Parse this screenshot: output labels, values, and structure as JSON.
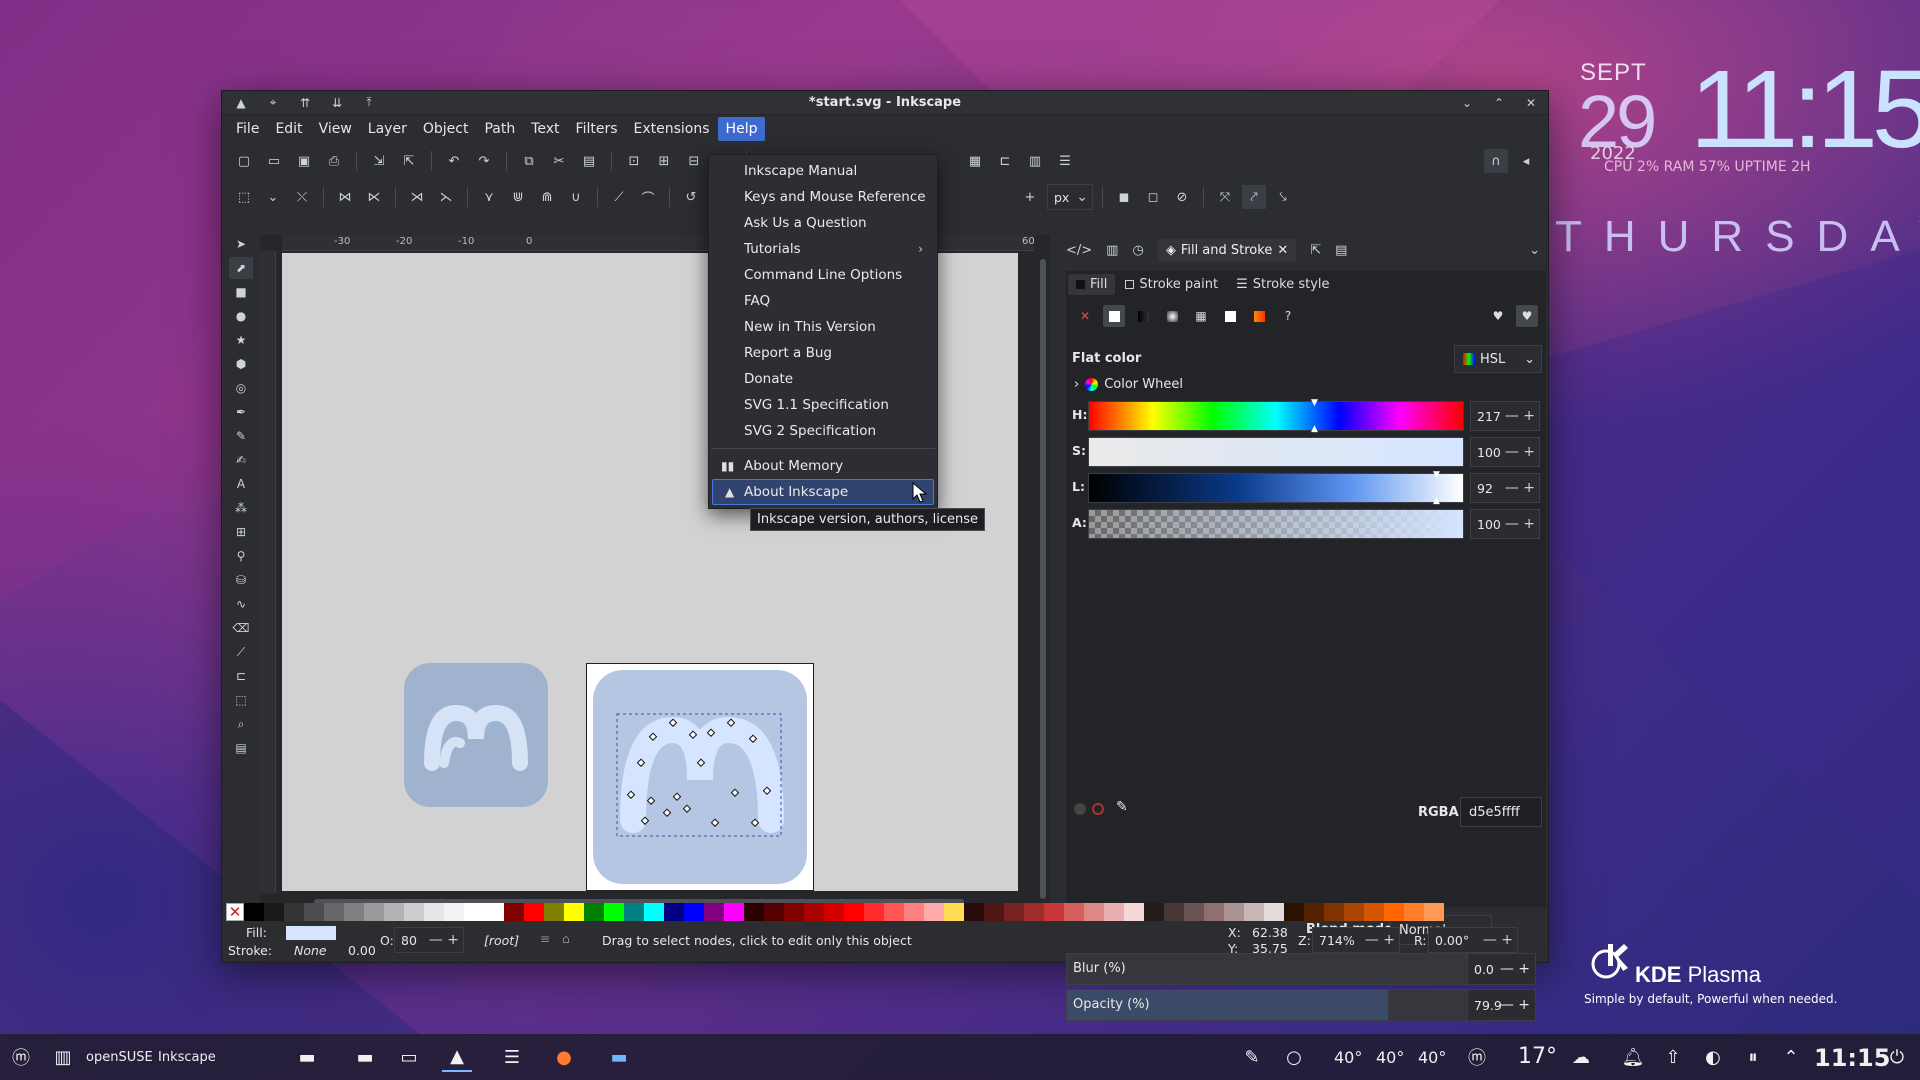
{
  "desktop": {
    "clock": {
      "month": "SEPT",
      "day": "29",
      "time": "11:15",
      "year": "2022",
      "stats": "CPU 2% RAM 57% UPTIME 2H"
    },
    "weekday": "THURSDAY",
    "kde": {
      "name_bold": "KDE",
      "name_rest": " Plasma",
      "tagline": "Simple by default, Powerful when needed."
    }
  },
  "window": {
    "title": "*start.svg - Inkscape",
    "menubar": [
      "File",
      "Edit",
      "View",
      "Layer",
      "Object",
      "Path",
      "Text",
      "Filters",
      "Extensions",
      "Help"
    ],
    "active_menu": "Help",
    "unit": "px",
    "ruler_ticks": [
      "-30",
      "-20",
      "-10",
      "0",
      "60"
    ]
  },
  "help_menu": {
    "items": [
      "Inkscape Manual",
      "Keys and Mouse Reference",
      "Ask Us a Question",
      "Tutorials",
      "Command Line Options",
      "FAQ",
      "New in This Version",
      "Report a Bug",
      "Donate",
      "SVG 1.1 Specification",
      "SVG 2 Specification"
    ],
    "items2": [
      "About Memory",
      "About Inkscape"
    ],
    "tooltip": "Inkscape version, authors, license"
  },
  "dock": {
    "tab_label": "Fill and Stroke",
    "subtabs": [
      "Fill",
      "Stroke paint",
      "Stroke style"
    ],
    "flat_color": "Flat color",
    "mode": "HSL",
    "color_wheel": "Color Wheel",
    "sliders": [
      {
        "label": "H:",
        "value": "217"
      },
      {
        "label": "S:",
        "value": "100"
      },
      {
        "label": "L:",
        "value": "92"
      },
      {
        "label": "A:",
        "value": "100"
      }
    ],
    "rgba_label": "RGBA:",
    "rgba_value": "d5e5ffff",
    "blend_label": "Blend mode:",
    "blend_value": "Normal",
    "blur_label": "Blur (%)",
    "blur_value": "0.0",
    "opacity_label": "Opacity (%)",
    "opacity_value": "79.9",
    "opacity_fraction": 0.799
  },
  "status": {
    "fill_label": "Fill:",
    "stroke_label": "Stroke:",
    "stroke_value": "None",
    "stroke_width": "0.00",
    "o_label": "O:",
    "o_value": "80",
    "layer": "[root]",
    "message": "Drag to select nodes, click to edit only this object",
    "x_label": "X:",
    "x_value": "62.38",
    "y_label": "Y:",
    "y_value": "35.75",
    "z_label": "Z:",
    "z_value": "714%",
    "r_label": "R:",
    "r_value": "0.00°"
  },
  "taskbar": {
    "distro": "openSUSE",
    "app": "Inkscape",
    "temps": [
      "40°",
      "40°",
      "40°"
    ],
    "weather": "17°",
    "time": "11:15"
  },
  "colors": {
    "accent": "#3d6bd0",
    "fill_swatch": "#d5e5ff",
    "tile": "#aebfd9"
  },
  "icons": {
    "menu_icon": "bar-chart-icon",
    "about_icon": "inkscape-icon"
  }
}
